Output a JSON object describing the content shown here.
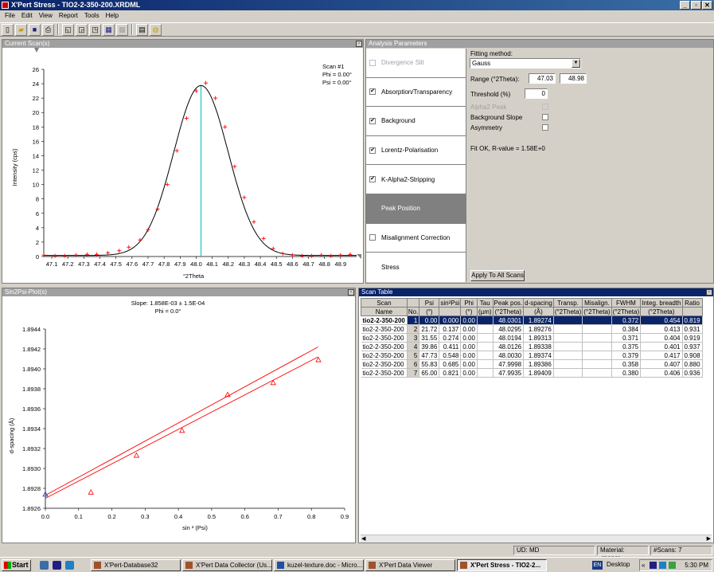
{
  "window": {
    "title": "X'Pert Stress - TIO2-2-350-200.XRDML",
    "buttons": [
      "_",
      "▫",
      "✕"
    ]
  },
  "menu": [
    "File",
    "Edit",
    "View",
    "Report",
    "Tools",
    "Help"
  ],
  "toolbar": {
    "icons": [
      "new-file-icon",
      "open-folder-icon",
      "save-icon",
      "print-icon",
      "layout-1-icon",
      "layout-2-icon",
      "layout-3-icon",
      "grid-icon",
      "grid-disabled-icon",
      "table-icon",
      "select-icon"
    ],
    "glyphs": [
      "▯",
      "▰",
      "■",
      "⎙",
      "◱",
      "◲",
      "◳",
      "▦",
      "▦",
      "▤",
      "◍"
    ]
  },
  "current_scan": {
    "panel_title": "Current Scan(s)",
    "xlabel": "°2Theta",
    "ylabel": "Intensity (cps)",
    "legend": [
      "Scan #1",
      "Phi = 0.00°",
      "Psi = 0.00°"
    ]
  },
  "sin2psi": {
    "panel_title": "Sin2Psi-Plot(s)",
    "title_line1": "Slope: 1.858E-03 ± 1.5E-04",
    "title_line2": "Phi = 0.0°",
    "xlabel": "sin ² (Psi)",
    "ylabel": "d-spacing (Å)"
  },
  "chart_data": [
    {
      "type": "scatter",
      "title": "",
      "xlabel": "°2Theta",
      "ylabel": "Intensity (cps)",
      "xlim": [
        47.05,
        49.0
      ],
      "ylim": [
        0,
        26
      ],
      "xticks": [
        "47.1",
        "47.2",
        "47.3",
        "47.4",
        "47.5",
        "47.6",
        "47.7",
        "47.8",
        "47.9",
        "48.0",
        "48.1",
        "48.2",
        "48.3",
        "48.4",
        "48.5",
        "48.6",
        "48.7",
        "48.8",
        "48.9"
      ],
      "yticks": [
        "0",
        "2",
        "4",
        "6",
        "8",
        "10",
        "12",
        "14",
        "16",
        "18",
        "20",
        "22",
        "24",
        "26"
      ],
      "series": [
        {
          "x": [
            47.05,
            47.12,
            47.18,
            47.25,
            47.32,
            47.38,
            47.45,
            47.52,
            47.58,
            47.65,
            47.7,
            47.76,
            47.82,
            47.88,
            47.94,
            48.0,
            48.06,
            48.12,
            48.18,
            48.24,
            48.3,
            48.36,
            48.42,
            48.48,
            48.54,
            48.6,
            48.66,
            48.72,
            48.78,
            48.84,
            48.9,
            48.96
          ],
          "values": [
            0.2,
            0.1,
            0.1,
            0.2,
            0.3,
            0.3,
            0.5,
            0.8,
            1.3,
            2.3,
            3.7,
            6.6,
            10.0,
            14.7,
            19.2,
            23.0,
            24.1,
            22.0,
            18.0,
            12.5,
            8.2,
            4.8,
            2.5,
            1.1,
            0.4,
            0.2,
            0.1,
            0.1,
            0.2,
            0.1,
            0.2,
            0.3
          ]
        }
      ],
      "fit_curve": {
        "model": "Gauss",
        "center": 48.03,
        "amplitude": 23.6,
        "sigma": 0.17,
        "baseline": 0.15
      },
      "peak_marker_x": 48.03
    },
    {
      "type": "scatter",
      "title": "Slope: 1.858E-03 ± 1.5E-04",
      "xlabel": "sin ² (Psi)",
      "ylabel": "d-spacing (Å)",
      "xlim": [
        0.0,
        0.9
      ],
      "ylim": [
        1.8926,
        1.8944
      ],
      "xticks": [
        "0.0",
        "0.1",
        "0.2",
        "0.3",
        "0.4",
        "0.5",
        "0.6",
        "0.7",
        "0.8",
        "0.9"
      ],
      "yticks": [
        "1.8926",
        "1.8928",
        "1.8930",
        "1.8932",
        "1.8934",
        "1.8936",
        "1.8938",
        "1.8940",
        "1.8942",
        "1.8944"
      ],
      "series": [
        {
          "x": [
            0.0,
            0.137,
            0.274,
            0.411,
            0.548,
            0.685,
            0.821
          ],
          "values": [
            1.89274,
            1.89276,
            1.89313,
            1.89338,
            1.89374,
            1.89386,
            1.89409
          ]
        }
      ],
      "fit_lines": [
        {
          "x": [
            0.0,
            0.82
          ],
          "values": [
            1.8927,
            1.89412
          ]
        },
        {
          "x": [
            0.0,
            0.82
          ],
          "values": [
            1.89273,
            1.89422
          ]
        }
      ]
    }
  ],
  "analysis": {
    "panel_title": "Analysis Parameters",
    "items": [
      {
        "label": "Divergence Slit",
        "checked": false,
        "disabled": true
      },
      {
        "label": "Absorption/Transparency",
        "checked": true
      },
      {
        "label": "Background",
        "checked": true
      },
      {
        "label": "Lorentz-Polarisation",
        "checked": true
      },
      {
        "label": "K-Alpha2-Stripping",
        "checked": true
      },
      {
        "label": "Peak Position",
        "selected": true
      },
      {
        "label": "Misalignment Correction",
        "checked": false
      },
      {
        "label": "Stress",
        "nocheck": true
      }
    ],
    "fitting_method_label": "Fitting method:",
    "fitting_method": "Gauss",
    "range_label": "Range (°2Theta):",
    "range_from": "47.03",
    "range_to": "48.98",
    "threshold_label": "Threshold (%)",
    "threshold": "0",
    "alpha2_label": "Alpha2 Peak",
    "bg_slope_label": "Background Slope",
    "asymmetry_label": "Asymmetry",
    "fit_status": "Fit OK, R-value = 1.58E+0",
    "apply_button": "Apply To All Scans"
  },
  "scan_table": {
    "panel_title": "Scan Table",
    "headers1": [
      "Scan",
      "",
      "Psi",
      "sin²Psi",
      "Phi",
      "Tau",
      "Peak pos.",
      "d-spacing",
      "Transp.",
      "Misalign.",
      "FWHM",
      "Integ. breadth",
      "Ratio"
    ],
    "headers2": [
      "Name",
      "No.",
      "(°)",
      "",
      "(°)",
      "(µm)",
      "(°2Theta)",
      "(Å)",
      "(°2Theta)",
      "(°2Theta)",
      "(°2Theta)",
      "(°2Theta)",
      ""
    ],
    "rows": [
      [
        "tio2-2-350-200",
        "1",
        "0.00",
        "0.000",
        "0.00",
        "",
        "48.0301",
        "1.89274",
        "",
        "",
        "0.372",
        "0.454",
        "0.819"
      ],
      [
        "tio2-2-350-200",
        "2",
        "21.72",
        "0.137",
        "0.00",
        "",
        "48.0295",
        "1.89276",
        "",
        "",
        "0.384",
        "0.413",
        "0.931"
      ],
      [
        "tio2-2-350-200",
        "3",
        "31.55",
        "0.274",
        "0.00",
        "",
        "48.0194",
        "1.89313",
        "",
        "",
        "0.371",
        "0.404",
        "0.919"
      ],
      [
        "tio2-2-350-200",
        "4",
        "39.86",
        "0.411",
        "0.00",
        "",
        "48.0126",
        "1.89338",
        "",
        "",
        "0.375",
        "0.401",
        "0.937"
      ],
      [
        "tio2-2-350-200",
        "5",
        "47.73",
        "0.548",
        "0.00",
        "",
        "48.0030",
        "1.89374",
        "",
        "",
        "0.379",
        "0.417",
        "0.908"
      ],
      [
        "tio2-2-350-200",
        "6",
        "55.83",
        "0.685",
        "0.00",
        "",
        "47.9998",
        "1.89386",
        "",
        "",
        "0.358",
        "0.407",
        "0.880"
      ],
      [
        "tio2-2-350-200",
        "7",
        "65.00",
        "0.821",
        "0.00",
        "",
        "47.9935",
        "1.89409",
        "",
        "",
        "0.380",
        "0.406",
        "0.936"
      ]
    ]
  },
  "status": {
    "ud": "UD: MD",
    "material": "Material: <none>",
    "scans": "#Scans: 7"
  },
  "taskbar": {
    "start": "Start",
    "tasks": [
      "X'Pert-Database32",
      "X'Pert Data Collector (Us...",
      "kuzel-texture.doc - Micro...",
      "X'Pert Data Viewer",
      "X'Pert Stress - TIO2-2..."
    ],
    "lang": "EN",
    "desktop": "Desktop",
    "clock": "5:30 PM"
  },
  "colors": {
    "titlebar": "#0a246a",
    "marker": "#ff0000",
    "peak_line": "#00c0c0"
  }
}
